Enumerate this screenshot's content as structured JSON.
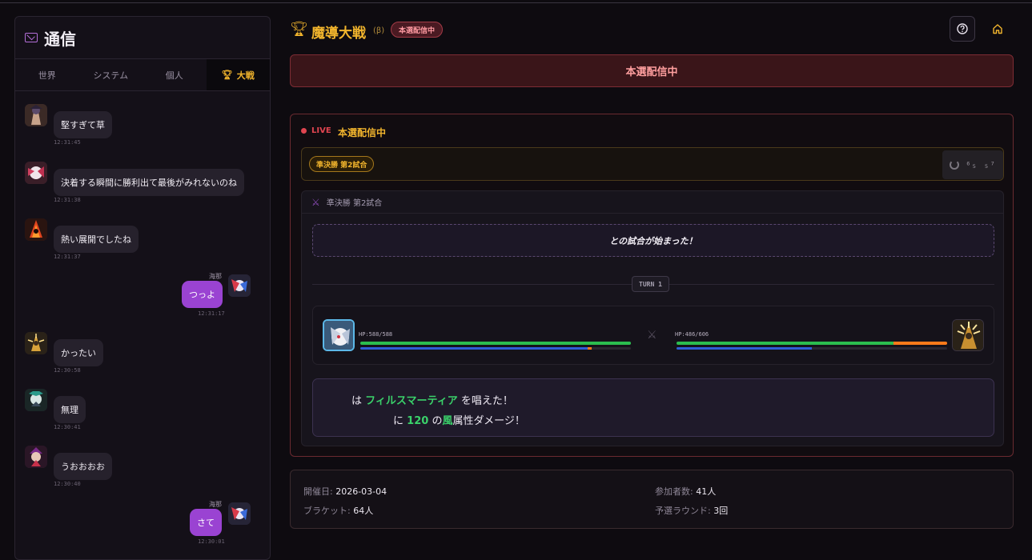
{
  "chat": {
    "title": "通信",
    "tabs": [
      "世界",
      "システム",
      "個人",
      "大戦"
    ],
    "messages": [
      {
        "text": "堅すぎて草",
        "time": "12:31:45",
        "self": false
      },
      {
        "text": "決着する瞬間に勝利出て最後がみれないのね",
        "time": "12:31:38",
        "self": false
      },
      {
        "text": "熱い展開でしたね",
        "time": "12:31:37",
        "self": false
      },
      {
        "text": "つっよ",
        "time": "12:31:17",
        "self": true,
        "sender": "海那"
      },
      {
        "text": "かったい",
        "time": "12:30:58",
        "self": false
      },
      {
        "text": "無理",
        "time": "12:30:41",
        "self": false
      },
      {
        "text": "うおおおお",
        "time": "12:30:40",
        "self": false
      },
      {
        "text": "さて",
        "time": "12:30:01",
        "self": true,
        "sender": "海那"
      }
    ]
  },
  "header": {
    "title": "魔導大戦",
    "beta": "(β)",
    "badge": "本選配信中"
  },
  "banner": "本選配信中",
  "live": {
    "label": "LIVE",
    "title": "本選配信中",
    "round_chip": "準決勝 第2試合",
    "loading_text": "⁶₅ ₅⁷",
    "match_label": "準決勝 第2試合",
    "start_text": "との試合が始まった！",
    "turn": "TURN 1",
    "left_fighter": {
      "hp_text": "HP:588/588",
      "hp": 588,
      "hp_max": 588,
      "damage_pct": 0,
      "mp_pct": 0.84,
      "mp_orange_pct": 0.015
    },
    "right_fighter": {
      "hp_text": "HP:486/606",
      "hp": 486,
      "hp_max": 606,
      "mp_pct": 0.5
    },
    "log": {
      "line1_pre": "は",
      "spell": "フィルスマーティア",
      "line1_post": "を唱えた！",
      "line2_pre": "に",
      "damage": "120",
      "line2_mid": "の",
      "element": "風",
      "line2_post": "属性ダメージ！"
    }
  },
  "info": {
    "date_label": "開催日:",
    "date": "2026-03-04",
    "participants_label": "参加者数:",
    "participants": "41人",
    "bracket_label": "ブラケット:",
    "bracket": "64人",
    "qualifier_label": "予選ラウンド:",
    "qualifier": "3回"
  },
  "colors": {
    "accent": "#f2b52d",
    "live": "#e04550",
    "self_bubble": "#9a43d2",
    "hp": "#2bbd4f",
    "mp": "#2f5ed6",
    "damage": "#ff7a1a"
  }
}
